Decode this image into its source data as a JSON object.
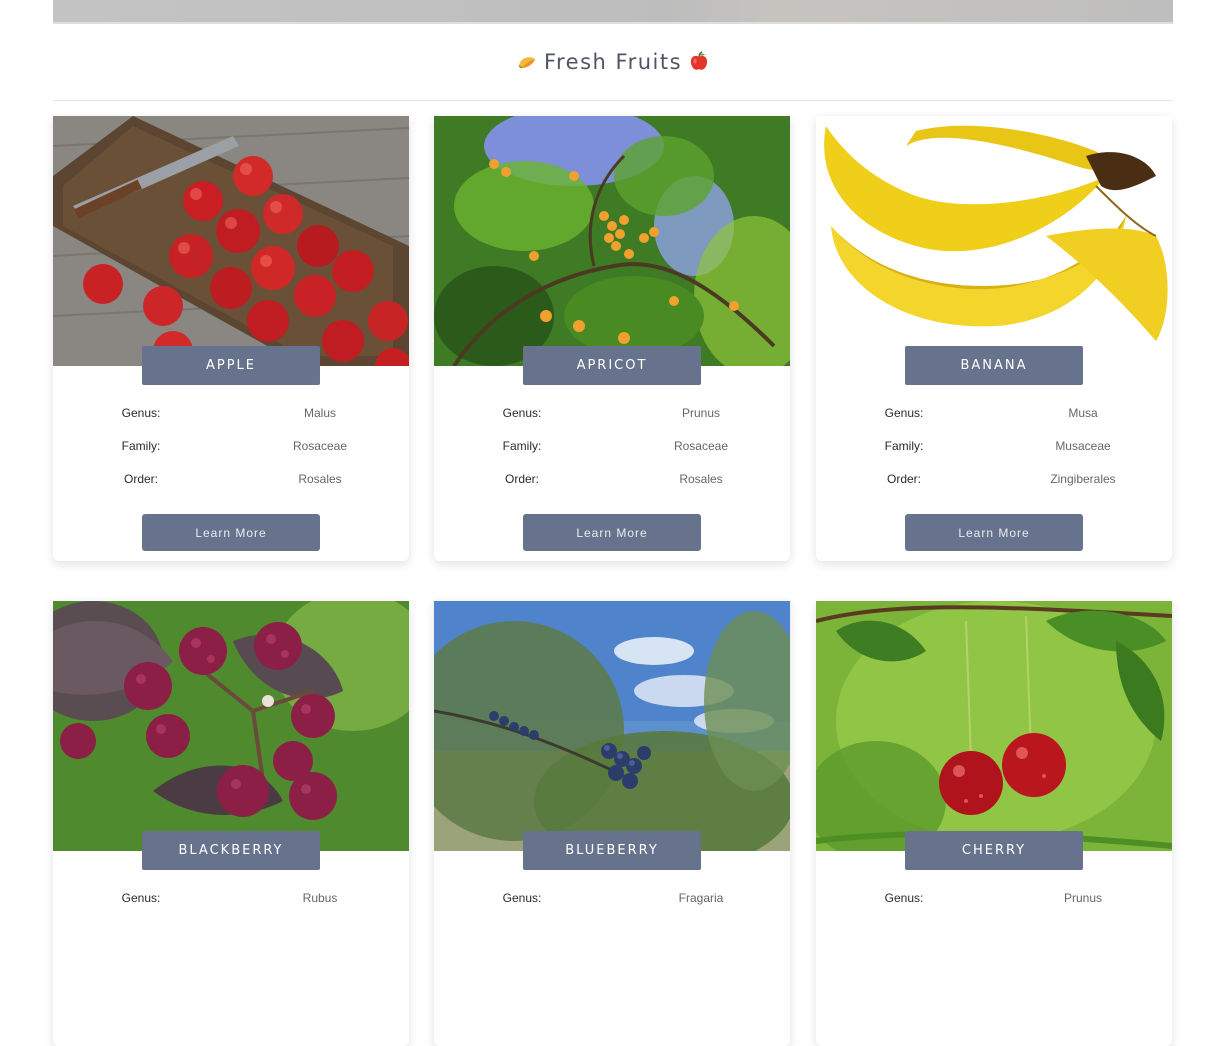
{
  "page": {
    "title": "Fresh Fruits",
    "title_left_icon": "mango-emoji-icon",
    "title_right_icon": "apple-emoji-icon"
  },
  "labels": {
    "genus": "Genus:",
    "family": "Family:",
    "order": "Order:",
    "learn_more": "Learn More"
  },
  "fruits": [
    {
      "name": "APPLE",
      "genus": "Malus",
      "family": "Rosaceae",
      "order": "Rosales",
      "image": "apples-on-cutting-board-image"
    },
    {
      "name": "APRICOT",
      "genus": "Prunus",
      "family": "Rosaceae",
      "order": "Rosales",
      "image": "apricot-tree-image"
    },
    {
      "name": "BANANA",
      "genus": "Musa",
      "family": "Musaceae",
      "order": "Zingiberales",
      "image": "banana-bunch-image"
    },
    {
      "name": "BLACKBERRY",
      "genus": "Rubus",
      "image": "blackberry-plant-image"
    },
    {
      "name": "BLUEBERRY",
      "genus": "Fragaria",
      "image": "blueberry-bush-image"
    },
    {
      "name": "CHERRY",
      "genus": "Prunus",
      "image": "cherries-on-branch-image"
    }
  ],
  "colors": {
    "accent": "#67738c",
    "heading_text": "#4f5562",
    "card_background": "#ffffff"
  }
}
